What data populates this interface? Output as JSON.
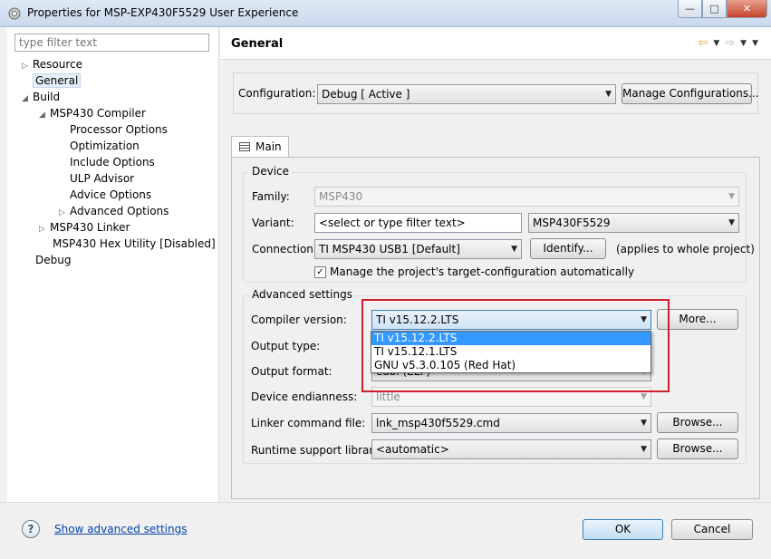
{
  "window": {
    "title": "Properties for MSP-EXP430F5529 User Experience"
  },
  "left": {
    "filter_placeholder": "type filter text",
    "tree": {
      "resource": "Resource",
      "general": "General",
      "build": "Build",
      "msp430_compiler": "MSP430 Compiler",
      "processor_options": "Processor Options",
      "optimization": "Optimization",
      "include_options": "Include Options",
      "ulp_advisor": "ULP Advisor",
      "advice_options": "Advice Options",
      "advanced_options": "Advanced Options",
      "msp430_linker": "MSP430 Linker",
      "msp430_hex": "MSP430 Hex Utility  [Disabled]",
      "debug": "Debug"
    }
  },
  "right": {
    "title": "General",
    "configuration_label": "Configuration:",
    "configuration_value": "Debug  [ Active ]",
    "manage_configs": "Manage Configurations...",
    "tab_main": "Main",
    "device": {
      "group": "Device",
      "family_label": "Family:",
      "family_value": "MSP430",
      "variant_label": "Variant:",
      "variant_filter": "<select or type filter text>",
      "variant_value": "MSP430F5529",
      "connection_label": "Connection:",
      "connection_value": "TI MSP430 USB1 [Default]",
      "identify": "Identify...",
      "applies_note": "(applies to whole project)",
      "manage_target": "Manage the project's target-configuration automatically"
    },
    "advanced": {
      "group": "Advanced settings",
      "compiler_label": "Compiler version:",
      "compiler_value": "TI v15.12.2.LTS",
      "more": "More...",
      "output_type_label": "Output type:",
      "output_format_label": "Output format:",
      "output_format_value": "eabi (ELF)",
      "endianness_label": "Device endianness:",
      "endianness_value": "little",
      "linker_label": "Linker command file:",
      "linker_value": "lnk_msp430f5529.cmd",
      "browse": "Browse...",
      "runtime_label": "Runtime support library:",
      "runtime_value": "<automatic>"
    },
    "compiler_options": [
      "TI v15.12.2.LTS",
      "TI v15.12.1.LTS",
      "GNU v5.3.0.105 (Red Hat)"
    ]
  },
  "bottom": {
    "help": "?",
    "show_advanced": "Show advanced settings",
    "ok": "OK",
    "cancel": "Cancel"
  }
}
